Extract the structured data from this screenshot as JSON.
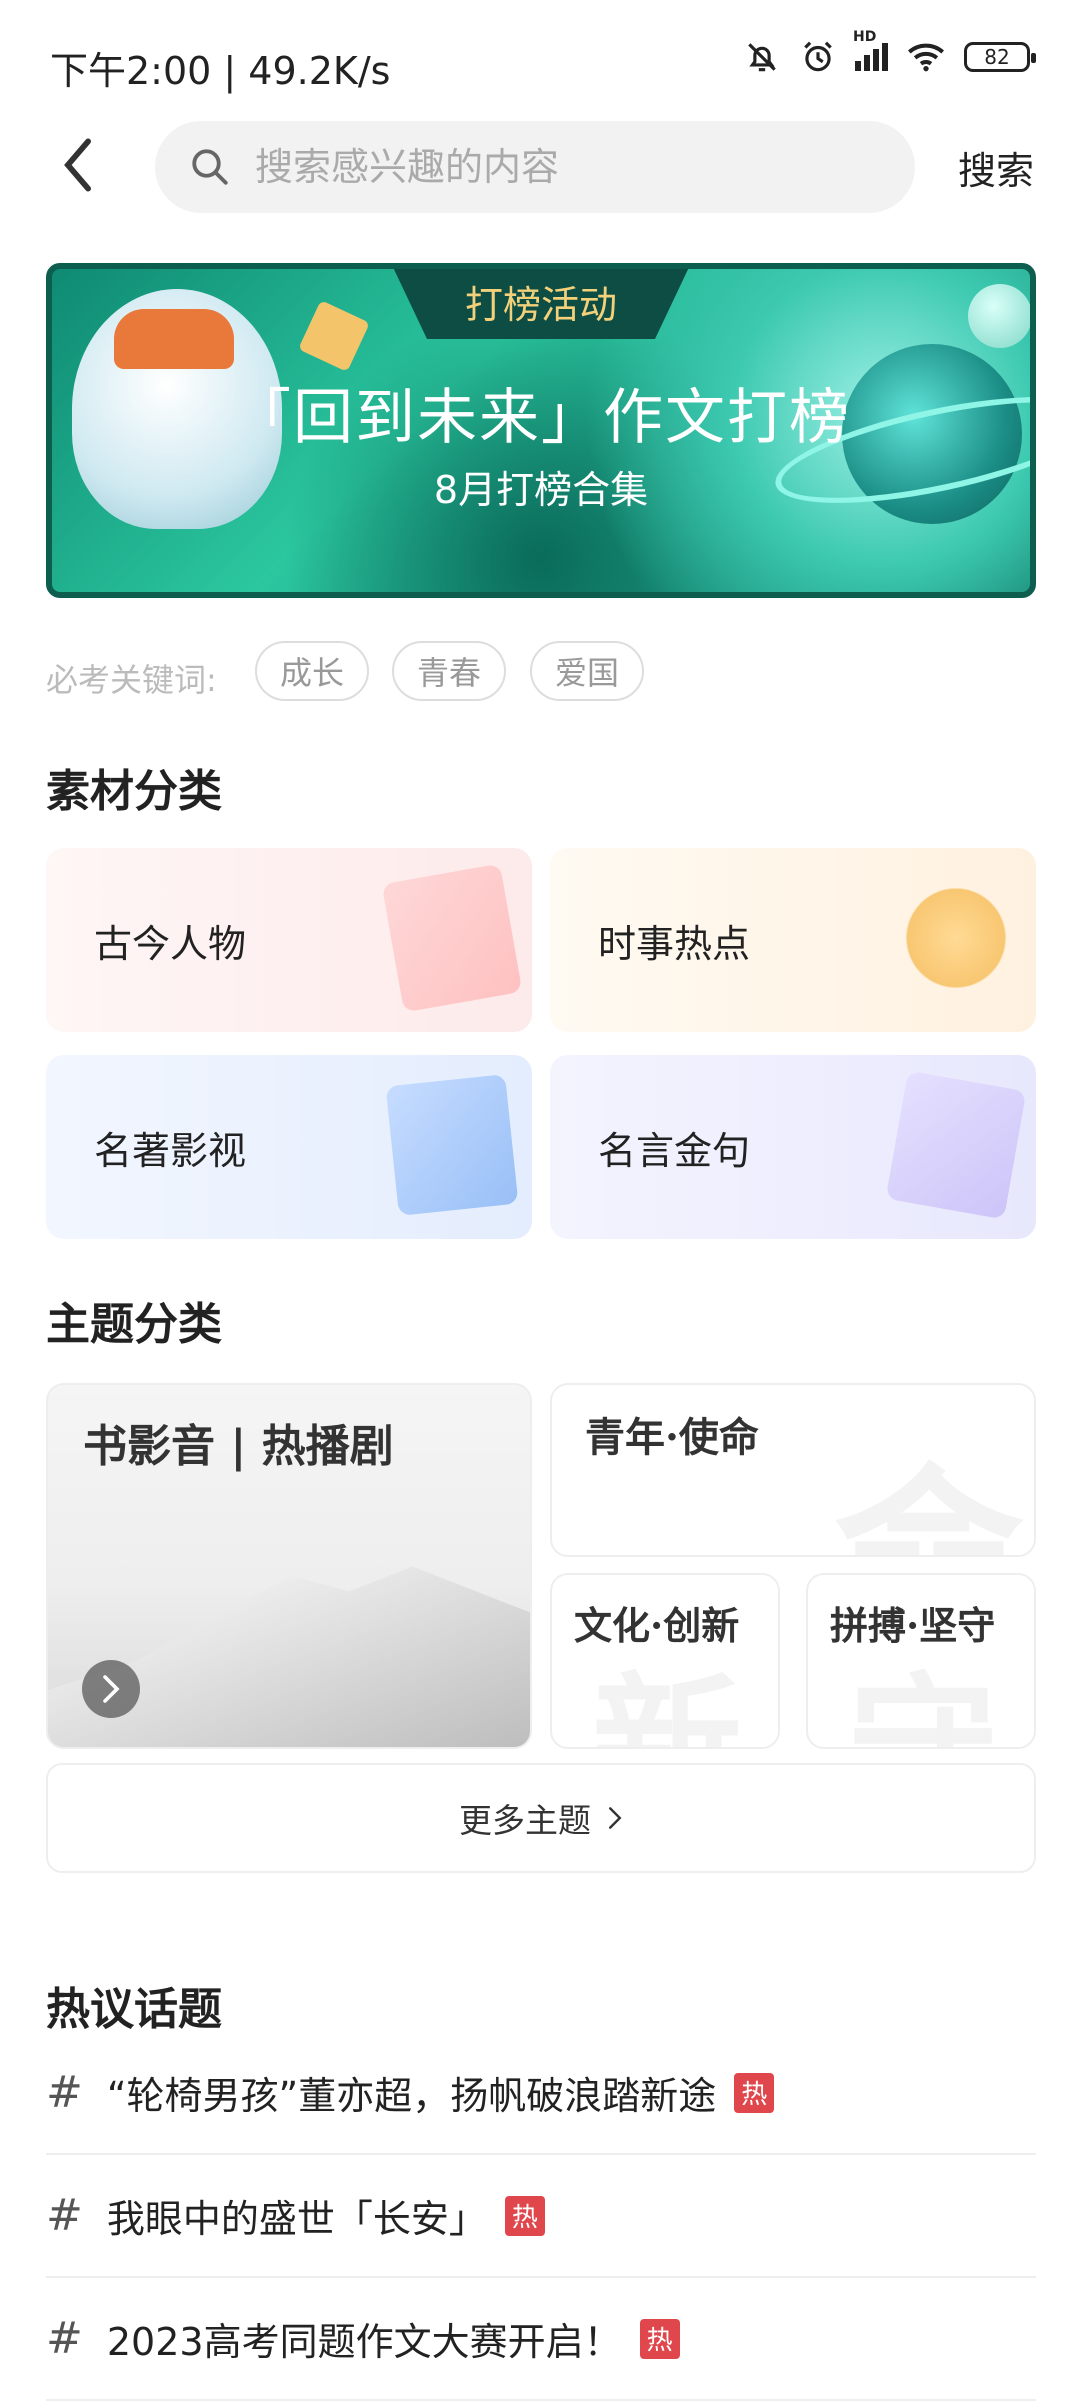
{
  "status_bar": {
    "time": "下午2:00 | 49.2K/s",
    "battery": "82",
    "network": "HD"
  },
  "header": {
    "search_placeholder": "搜索感兴趣的内容",
    "search_button": "搜索"
  },
  "banner": {
    "tag": "打榜活动",
    "title": "「回到未来」作文打榜",
    "subtitle": "8月打榜合集"
  },
  "keywords": {
    "label": "必考关键词:",
    "items": [
      "成长",
      "青春",
      "爱国"
    ]
  },
  "materials": {
    "title": "素材分类",
    "items": [
      {
        "label": "古今人物",
        "color": "#fdeeee"
      },
      {
        "label": "时事热点",
        "color": "#fff5e8"
      },
      {
        "label": "名著影视",
        "color": "#eaf1fd"
      },
      {
        "label": "名言金句",
        "color": "#eeeefd"
      }
    ]
  },
  "themes": {
    "title": "主题分类",
    "featured": "书影音 | 热播剧",
    "items": [
      "青年·使命",
      "文化·创新",
      "拼搏·坚守"
    ],
    "more": "更多主题"
  },
  "hot_topics": {
    "title": "热议话题",
    "badge": "热",
    "items": [
      "“轮椅男孩”董亦超，扬帆破浪踏新途",
      "我眼中的盛世「长安」",
      "2023高考同题作文大赛开启！"
    ]
  },
  "colors": {
    "accent_hot": "#e0474c",
    "banner_green": "#2bc79f"
  }
}
